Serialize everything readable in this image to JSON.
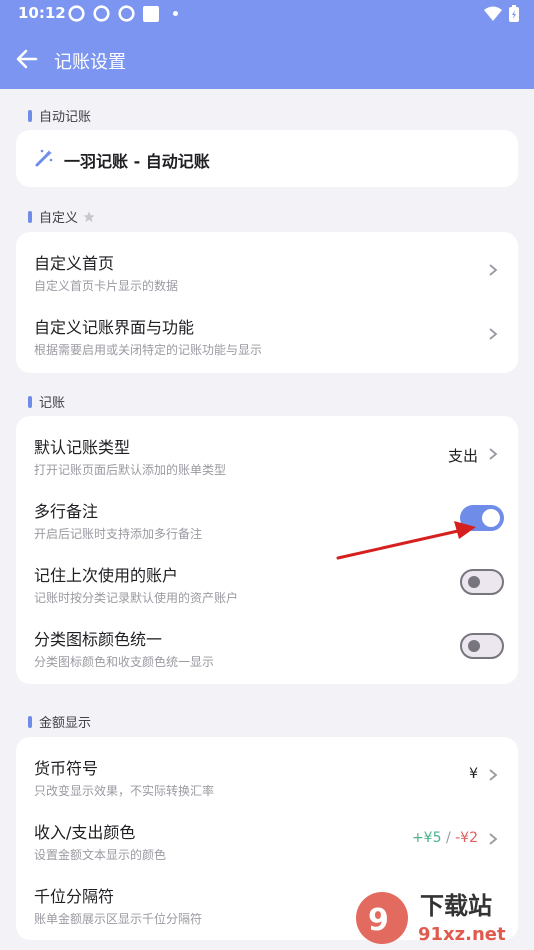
{
  "status_bar": {
    "time": "10:12"
  },
  "app_bar": {
    "title": "记账设置"
  },
  "sections": {
    "auto": {
      "title": "自动记账",
      "item": "一羽记账 - 自动记账"
    },
    "custom": {
      "title": "自定义",
      "items": [
        {
          "label": "自定义首页",
          "desc": "自定义首页卡片显示的数据"
        },
        {
          "label": "自定义记账界面与功能",
          "desc": "根据需要启用或关闭特定的记账功能与显示"
        }
      ]
    },
    "bookkeeping": {
      "title": "记账",
      "items": [
        {
          "label": "默认记账类型",
          "desc": "打开记账页面后默认添加的账单类型",
          "value": "支出"
        },
        {
          "label": "多行备注",
          "desc": "开启后记账时支持添加多行备注",
          "toggle": true
        },
        {
          "label": "记住上次使用的账户",
          "desc": "记账时按分类记录默认使用的资产账户",
          "toggle": false
        },
        {
          "label": "分类图标颜色统一",
          "desc": "分类图标颜色和收支颜色统一显示",
          "toggle": false
        }
      ]
    },
    "amount": {
      "title": "金额显示",
      "items": [
        {
          "label": "货币符号",
          "desc": "只改变显示效果，不实际转换汇率",
          "value": "¥"
        },
        {
          "label": "收入/支出颜色",
          "desc": "设置金额文本显示的颜色",
          "income": "+¥5",
          "separator": "/",
          "expense": "-¥2"
        },
        {
          "label": "千位分隔符",
          "desc": "账单金额展示区显示千位分隔符"
        }
      ]
    }
  },
  "colors": {
    "accent": "#7b95f0",
    "income": "#4cb38a",
    "expense": "#e0605f",
    "annotation_arrow": "#d62020"
  },
  "watermark": {
    "text": "下载站",
    "url_text": "91xz.net"
  }
}
